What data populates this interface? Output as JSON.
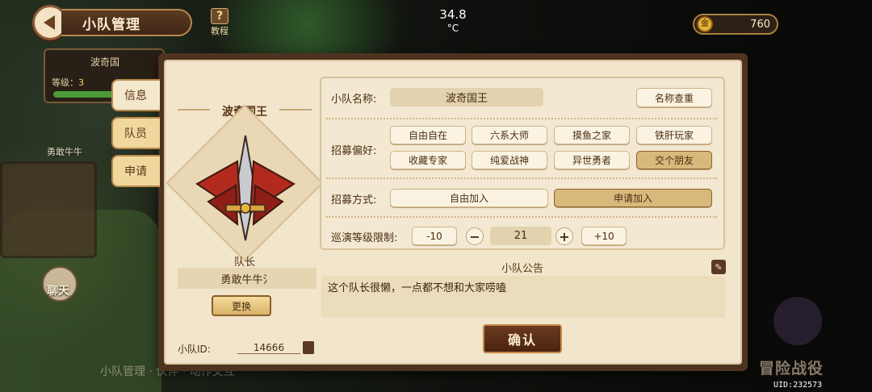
{
  "header": {
    "title": "小队管理",
    "tutorial_label": "教程",
    "temperature": "34.8",
    "temperature_unit": "°C",
    "gold_amount": "760"
  },
  "background": {
    "card_name": "波奇国",
    "level_label": "等级：",
    "level_value": "3",
    "ghost_name": "勇敢牛牛",
    "chat_label": "聊天",
    "scroll_text": "小队管理 · 伙伴 · 动作交互",
    "game_logo": "冒险战役",
    "uid": "UID:232573"
  },
  "tabs": [
    {
      "label": "信息",
      "active": true
    },
    {
      "label": "队员",
      "active": false
    },
    {
      "label": "申请",
      "active": false
    }
  ],
  "leader": {
    "team_name": "波奇国王",
    "leader_label": "队长",
    "leader_name": "勇敢牛牛氵",
    "change_button": "更换",
    "id_label": "小队ID:",
    "id_value": "14666"
  },
  "form": {
    "name_label": "小队名称:",
    "name_value": "波奇国王",
    "name_check_button": "名称查重",
    "pref_label": "招募偏好:",
    "preferences": [
      {
        "label": "自由自在",
        "selected": false
      },
      {
        "label": "六系大师",
        "selected": false
      },
      {
        "label": "摸鱼之家",
        "selected": false
      },
      {
        "label": "铁肝玩家",
        "selected": false
      },
      {
        "label": "收藏专家",
        "selected": false
      },
      {
        "label": "纯爱战神",
        "selected": false
      },
      {
        "label": "异世勇者",
        "selected": false
      },
      {
        "label": "交个朋友",
        "selected": true
      }
    ],
    "method_label": "招募方式:",
    "methods": [
      {
        "label": "自由加入",
        "selected": false
      },
      {
        "label": "申请加入",
        "selected": true
      }
    ],
    "level_limit_label": "巡演等级限制:",
    "minus10": "-10",
    "minus": "−",
    "level_value": "21",
    "plus": "+",
    "plus10": "+10"
  },
  "notice": {
    "title": "小队公告",
    "text": "这个队长很懒，一点都不想和大家唠嗑"
  },
  "confirm_button": "确认"
}
